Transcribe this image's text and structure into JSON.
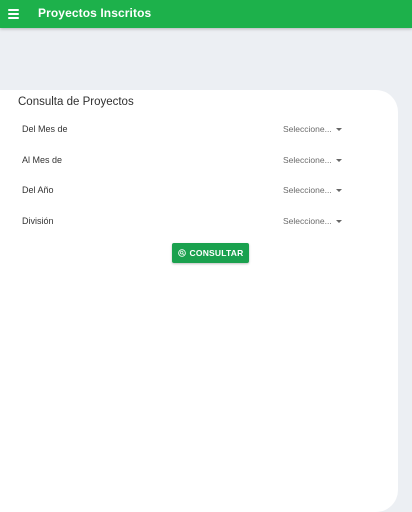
{
  "appbar": {
    "title": "Proyectos Inscritos",
    "menu_icon": "hamburger-menu-icon",
    "color": "#1db14b"
  },
  "form": {
    "title": "Consulta de Proyectos",
    "fields": [
      {
        "label": "Del Mes de",
        "value": "Seleccione..."
      },
      {
        "label": "Al Mes de",
        "value": "Seleccione..."
      },
      {
        "label": "Del Año",
        "value": "Seleccione..."
      },
      {
        "label": "División",
        "value": "Seleccione..."
      }
    ],
    "submit": {
      "label": "CONSULTAR",
      "icon": "search-circle-icon",
      "color": "#1aa14e"
    }
  }
}
